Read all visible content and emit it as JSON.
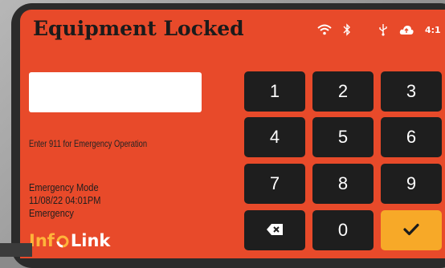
{
  "header": {
    "title": "Equipment Locked",
    "status_icons": [
      "wifi-icon",
      "bluetooth-icon",
      "usb-icon",
      "cloud-upload-icon"
    ],
    "time": "4:1"
  },
  "code_input": {
    "value": "",
    "placeholder": ""
  },
  "hint": "Enter 911 for Emergency Operation",
  "mode": {
    "label": "Emergency Mode",
    "datetime": "11/08/22 04:01PM",
    "status": "Emergency"
  },
  "logo": {
    "part1": "Inf",
    "part2": "Link"
  },
  "keypad": {
    "keys": [
      "1",
      "2",
      "3",
      "4",
      "5",
      "6",
      "7",
      "8",
      "9"
    ],
    "zero": "0",
    "backspace_icon": "backspace-icon",
    "confirm_icon": "checkmark-icon"
  },
  "colors": {
    "screen": "#e84a2a",
    "key": "#1e1e1e",
    "confirm": "#f7a928",
    "logo_accent": "#ffb43a"
  }
}
